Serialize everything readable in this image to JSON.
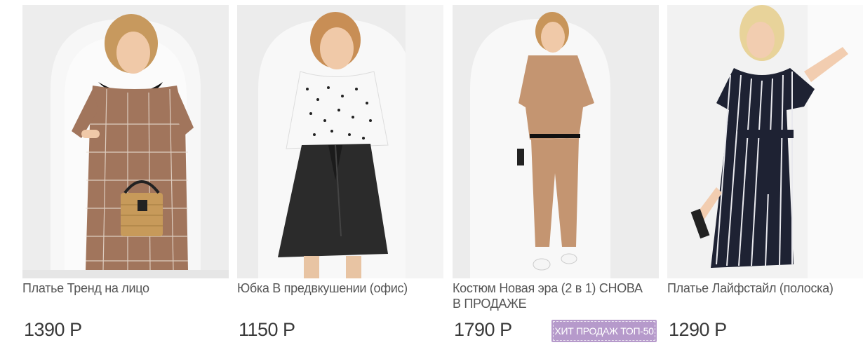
{
  "products": [
    {
      "title": "Платье Тренд на лицо",
      "price": "1390 Р",
      "image_alt": "Платье Тренд на лицо"
    },
    {
      "title": "Юбка В предвкушении (офис)",
      "price": "1150 Р",
      "image_alt": "Юбка В предвкушении (офис)"
    },
    {
      "title": "Костюм Новая эра (2 в 1) СНОВА В ПРОДАЖЕ",
      "price": "1790 Р",
      "badge": "ХИТ ПРОДАЖ ТОП-50",
      "image_alt": "Костюм Новая эра (2 в 1)"
    },
    {
      "title": "Платье Лайфстайл (полоска)",
      "price": "1290 Р",
      "image_alt": "Платье Лайфстайл (полоска)"
    }
  ],
  "colors": {
    "badge_background": "#b69acb",
    "price_text": "#3a3a3a",
    "title_text": "#555555",
    "photo_background": "#efefef"
  }
}
